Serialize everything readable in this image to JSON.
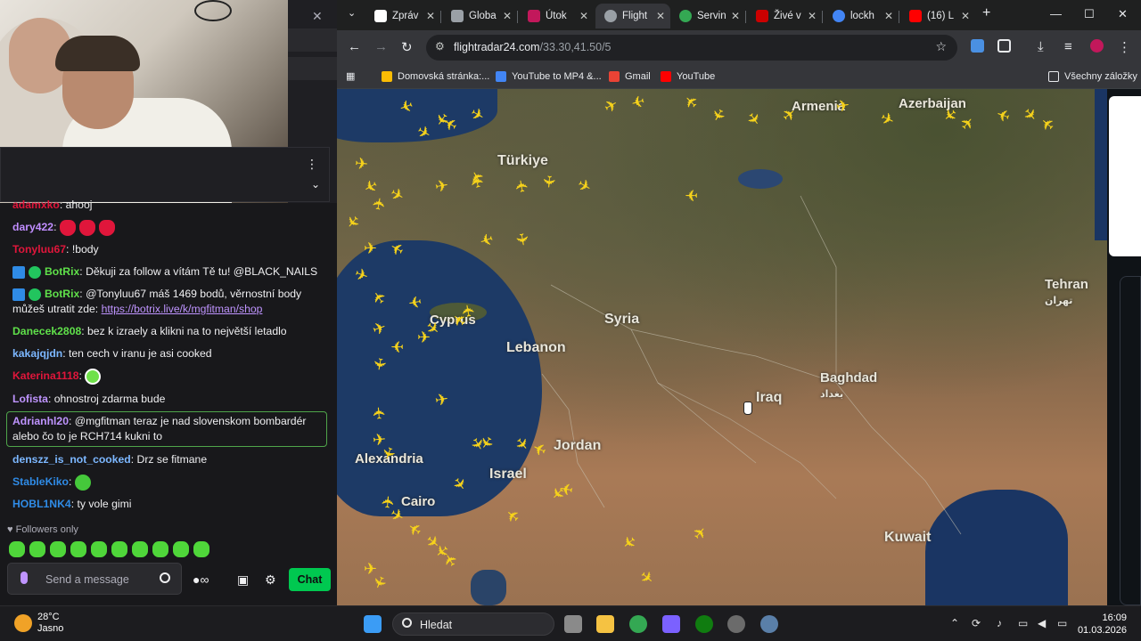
{
  "stream": {
    "chat_messages": [
      {
        "user": "adamxko",
        "user_color": "#e0163b",
        "text": "ahooj"
      },
      {
        "user": "dary422",
        "user_color": "#c08dff",
        "text": ""
      },
      {
        "user": "Tonyluu67",
        "user_color": "#e0163b",
        "text": "!body"
      },
      {
        "user": "BotRix",
        "user_color": "#5fe04a",
        "text": "Děkuji za follow a vítám Tě tu! @BLACK_NAILS"
      },
      {
        "user": "BotRix",
        "user_color": "#5fe04a",
        "text": "@Tonyluu67 máš 1469 bodů, věrnostní body můžeš utratit zde:",
        "link": "https://botrix.live/k/mgfitman/shop"
      },
      {
        "user": "Danecek2808",
        "user_color": "#5fe04a",
        "text": "bez k izraely a klikni na to největší letadlo"
      },
      {
        "user": "kakajqjdn",
        "user_color": "#7cb7ff",
        "text": "ten cech v iranu je asi cooked"
      },
      {
        "user": "Katerina1118",
        "user_color": "#e0163b",
        "text": ""
      },
      {
        "user": "Lofista",
        "user_color": "#bf94ff",
        "text": "ohnostroj zdarma bude"
      },
      {
        "user": "Adrianhl20",
        "user_color": "#bf94ff",
        "text": "@mgfitman teraz je nad slovenskom bombardér alebo čo to je RCH714 kukni to"
      },
      {
        "user": "denszz_is_not_cooked",
        "user_color": "#7cb7ff",
        "text": "Drz se fitmane"
      },
      {
        "user": "StableKiko",
        "user_color": "#2f8be6",
        "text": ""
      },
      {
        "user": "HOBL1NK4",
        "user_color": "#2f8be6",
        "text": "ty vole gimi"
      }
    ],
    "followers_only": "Followers only",
    "send_placeholder": "Send a message",
    "chat_button": "Chat"
  },
  "browser": {
    "tabs": [
      {
        "label": "Zpráv",
        "fav_color": "#ffffff",
        "active": false
      },
      {
        "label": "Globa",
        "fav_color": "#9aa0a6",
        "active": false
      },
      {
        "label": "Útok",
        "fav_color": "#c2185b",
        "active": false
      },
      {
        "label": "Flight",
        "fav_color": "#9aa0a6",
        "active": true
      },
      {
        "label": "Servin",
        "fav_color": "#34a853",
        "active": false
      },
      {
        "label": "Živé v",
        "fav_color": "#cc0000",
        "active": false
      },
      {
        "label": "lockh",
        "fav_color": "#4285f4",
        "active": false
      },
      {
        "label": "(16) L",
        "fav_color": "#ff0000",
        "active": false
      }
    ],
    "url_host": "flightradar24.com",
    "url_path": "/33.30,41.50/5",
    "bookmarks": [
      {
        "label": "Domovská stránka:...",
        "color": "#fbbc04"
      },
      {
        "label": "YouTube to MP4 &...",
        "color": "#4285f4"
      },
      {
        "label": "Gmail",
        "color": "#ea4335"
      },
      {
        "label": "YouTube",
        "color": "#ff0000"
      }
    ],
    "all_bookmarks": "Všechny záložky"
  },
  "map": {
    "labels": [
      {
        "text": "Türkiye"
      },
      {
        "text": "Syria"
      },
      {
        "text": "Lebanon"
      },
      {
        "text": "Iraq"
      },
      {
        "text": "Baghdad"
      },
      {
        "text": "بغداد"
      },
      {
        "text": "Jordan"
      },
      {
        "text": "Israel"
      },
      {
        "text": "Alexandria"
      },
      {
        "text": "Cairo"
      },
      {
        "text": "Kuwait"
      },
      {
        "text": "Tehran"
      },
      {
        "text": "تهران"
      },
      {
        "text": "Armenia"
      },
      {
        "text": "Azerbaijan"
      },
      {
        "text": "Cyprus"
      }
    ]
  },
  "taskbar": {
    "temp": "28°C",
    "weather": "Jasno",
    "search_placeholder": "Hledat",
    "time": "16:09",
    "date": "01.03.2026"
  }
}
